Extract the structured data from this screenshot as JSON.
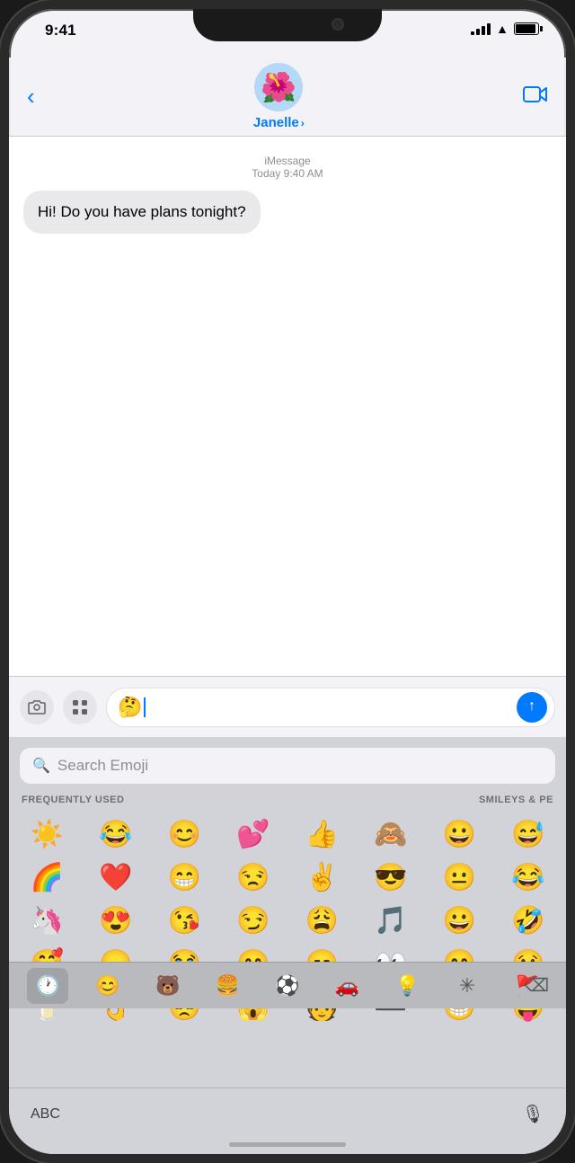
{
  "status_bar": {
    "time": "9:41"
  },
  "header": {
    "back_label": "‹",
    "contact_name": "Janelle",
    "contact_chevron": "›",
    "contact_avatar": "🌺",
    "video_icon": "📹"
  },
  "messages": {
    "service_label": "iMessage",
    "timestamp": "Today 9:40 AM",
    "bubble_text": "Hi! Do you have plans tonight?"
  },
  "input": {
    "emoji_typed": "🤔",
    "send_icon": "↑"
  },
  "emoji_keyboard": {
    "search_placeholder": "Search Emoji",
    "category_left": "FREQUENTLY USED",
    "category_right": "SMILEYS & PE",
    "frequently_used": [
      "☀️",
      "😂",
      "😊",
      "💕",
      "👍",
      "🙈",
      "😀",
      "😅",
      "🌈",
      "❤️",
      "😁",
      "😒",
      "✌️",
      "😎",
      "😐",
      "😂",
      "🦄",
      "😍",
      "😘",
      "😏",
      "😩",
      "🎵",
      "😀",
      "🤣",
      "🥰",
      "😞",
      "😭",
      "😄",
      "😑",
      "👀",
      "😄",
      "😢",
      "🥛",
      "👌",
      "😓",
      "😱",
      "🧑",
      "➖",
      "😁",
      "😛"
    ],
    "toolbar": [
      {
        "icon": "🕐",
        "label": "recent"
      },
      {
        "icon": "😊",
        "label": "smileys"
      },
      {
        "icon": "🐻",
        "label": "animals"
      },
      {
        "icon": "🍔",
        "label": "food"
      },
      {
        "icon": "⚽",
        "label": "activities"
      },
      {
        "icon": "🚗",
        "label": "travel"
      },
      {
        "icon": "💡",
        "label": "objects"
      },
      {
        "icon": "✳",
        "label": "symbols"
      },
      {
        "icon": "🚩",
        "label": "flags"
      }
    ]
  },
  "bottom_bar": {
    "abc_label": "ABC",
    "mic_icon": "🎙"
  }
}
